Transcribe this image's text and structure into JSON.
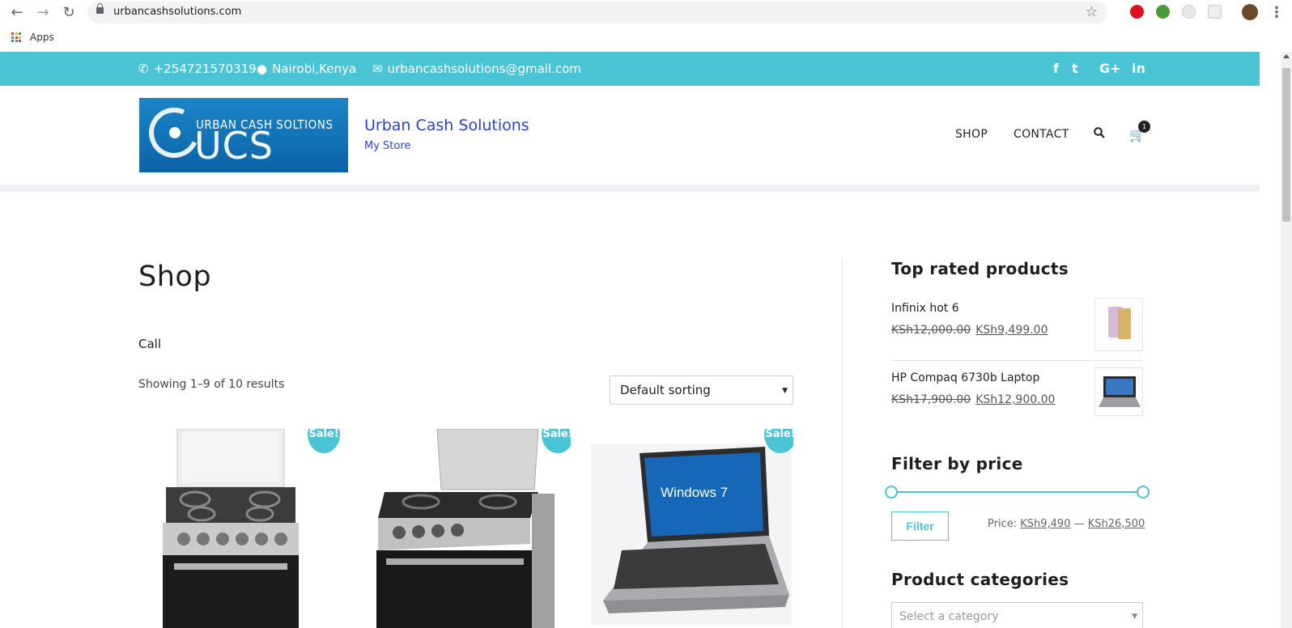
{
  "browser": {
    "url": "urbancashsolutions.com",
    "bookmarks_apps_label": "Apps"
  },
  "topbar": {
    "phone": "+254721570319",
    "location": "Nairobi,Kenya",
    "email": "urbancashsolutions@gmail.com",
    "social": [
      "f",
      "t",
      "G+",
      "in"
    ]
  },
  "header": {
    "logo_top_text": "URBAN CASH SOLTIONS",
    "logo_big_text": "UCS",
    "site_title": "Urban Cash Solutions",
    "site_description": "My Store",
    "menu": [
      "SHOP",
      "CONTACT"
    ],
    "cart_count": "1"
  },
  "main": {
    "title": "Shop",
    "intro": "Call",
    "results_text": "Showing 1–9 of 10 results",
    "sort_value": "Default sorting",
    "sale_badge": "Sale!"
  },
  "sidebar": {
    "top_rated_heading": "Top rated products",
    "top_rated": [
      {
        "name": "Infinix hot 6",
        "old_price": "KSh12,000.00",
        "price": "KSh9,499.00"
      },
      {
        "name": "HP Compaq 6730b Laptop",
        "old_price": "KSh17,900.00",
        "price": "KSh12,900.00"
      }
    ],
    "filter_heading": "Filter by price",
    "filter_button": "Filter",
    "price_label": "Price:",
    "price_min": "KSh9,490",
    "price_sep": "—",
    "price_max": "KSh26,500",
    "categories_heading": "Product categories",
    "category_placeholder": "Select a category"
  },
  "colors": {
    "accent": "#4bc4d6",
    "site_title": "#2b3fd8"
  }
}
